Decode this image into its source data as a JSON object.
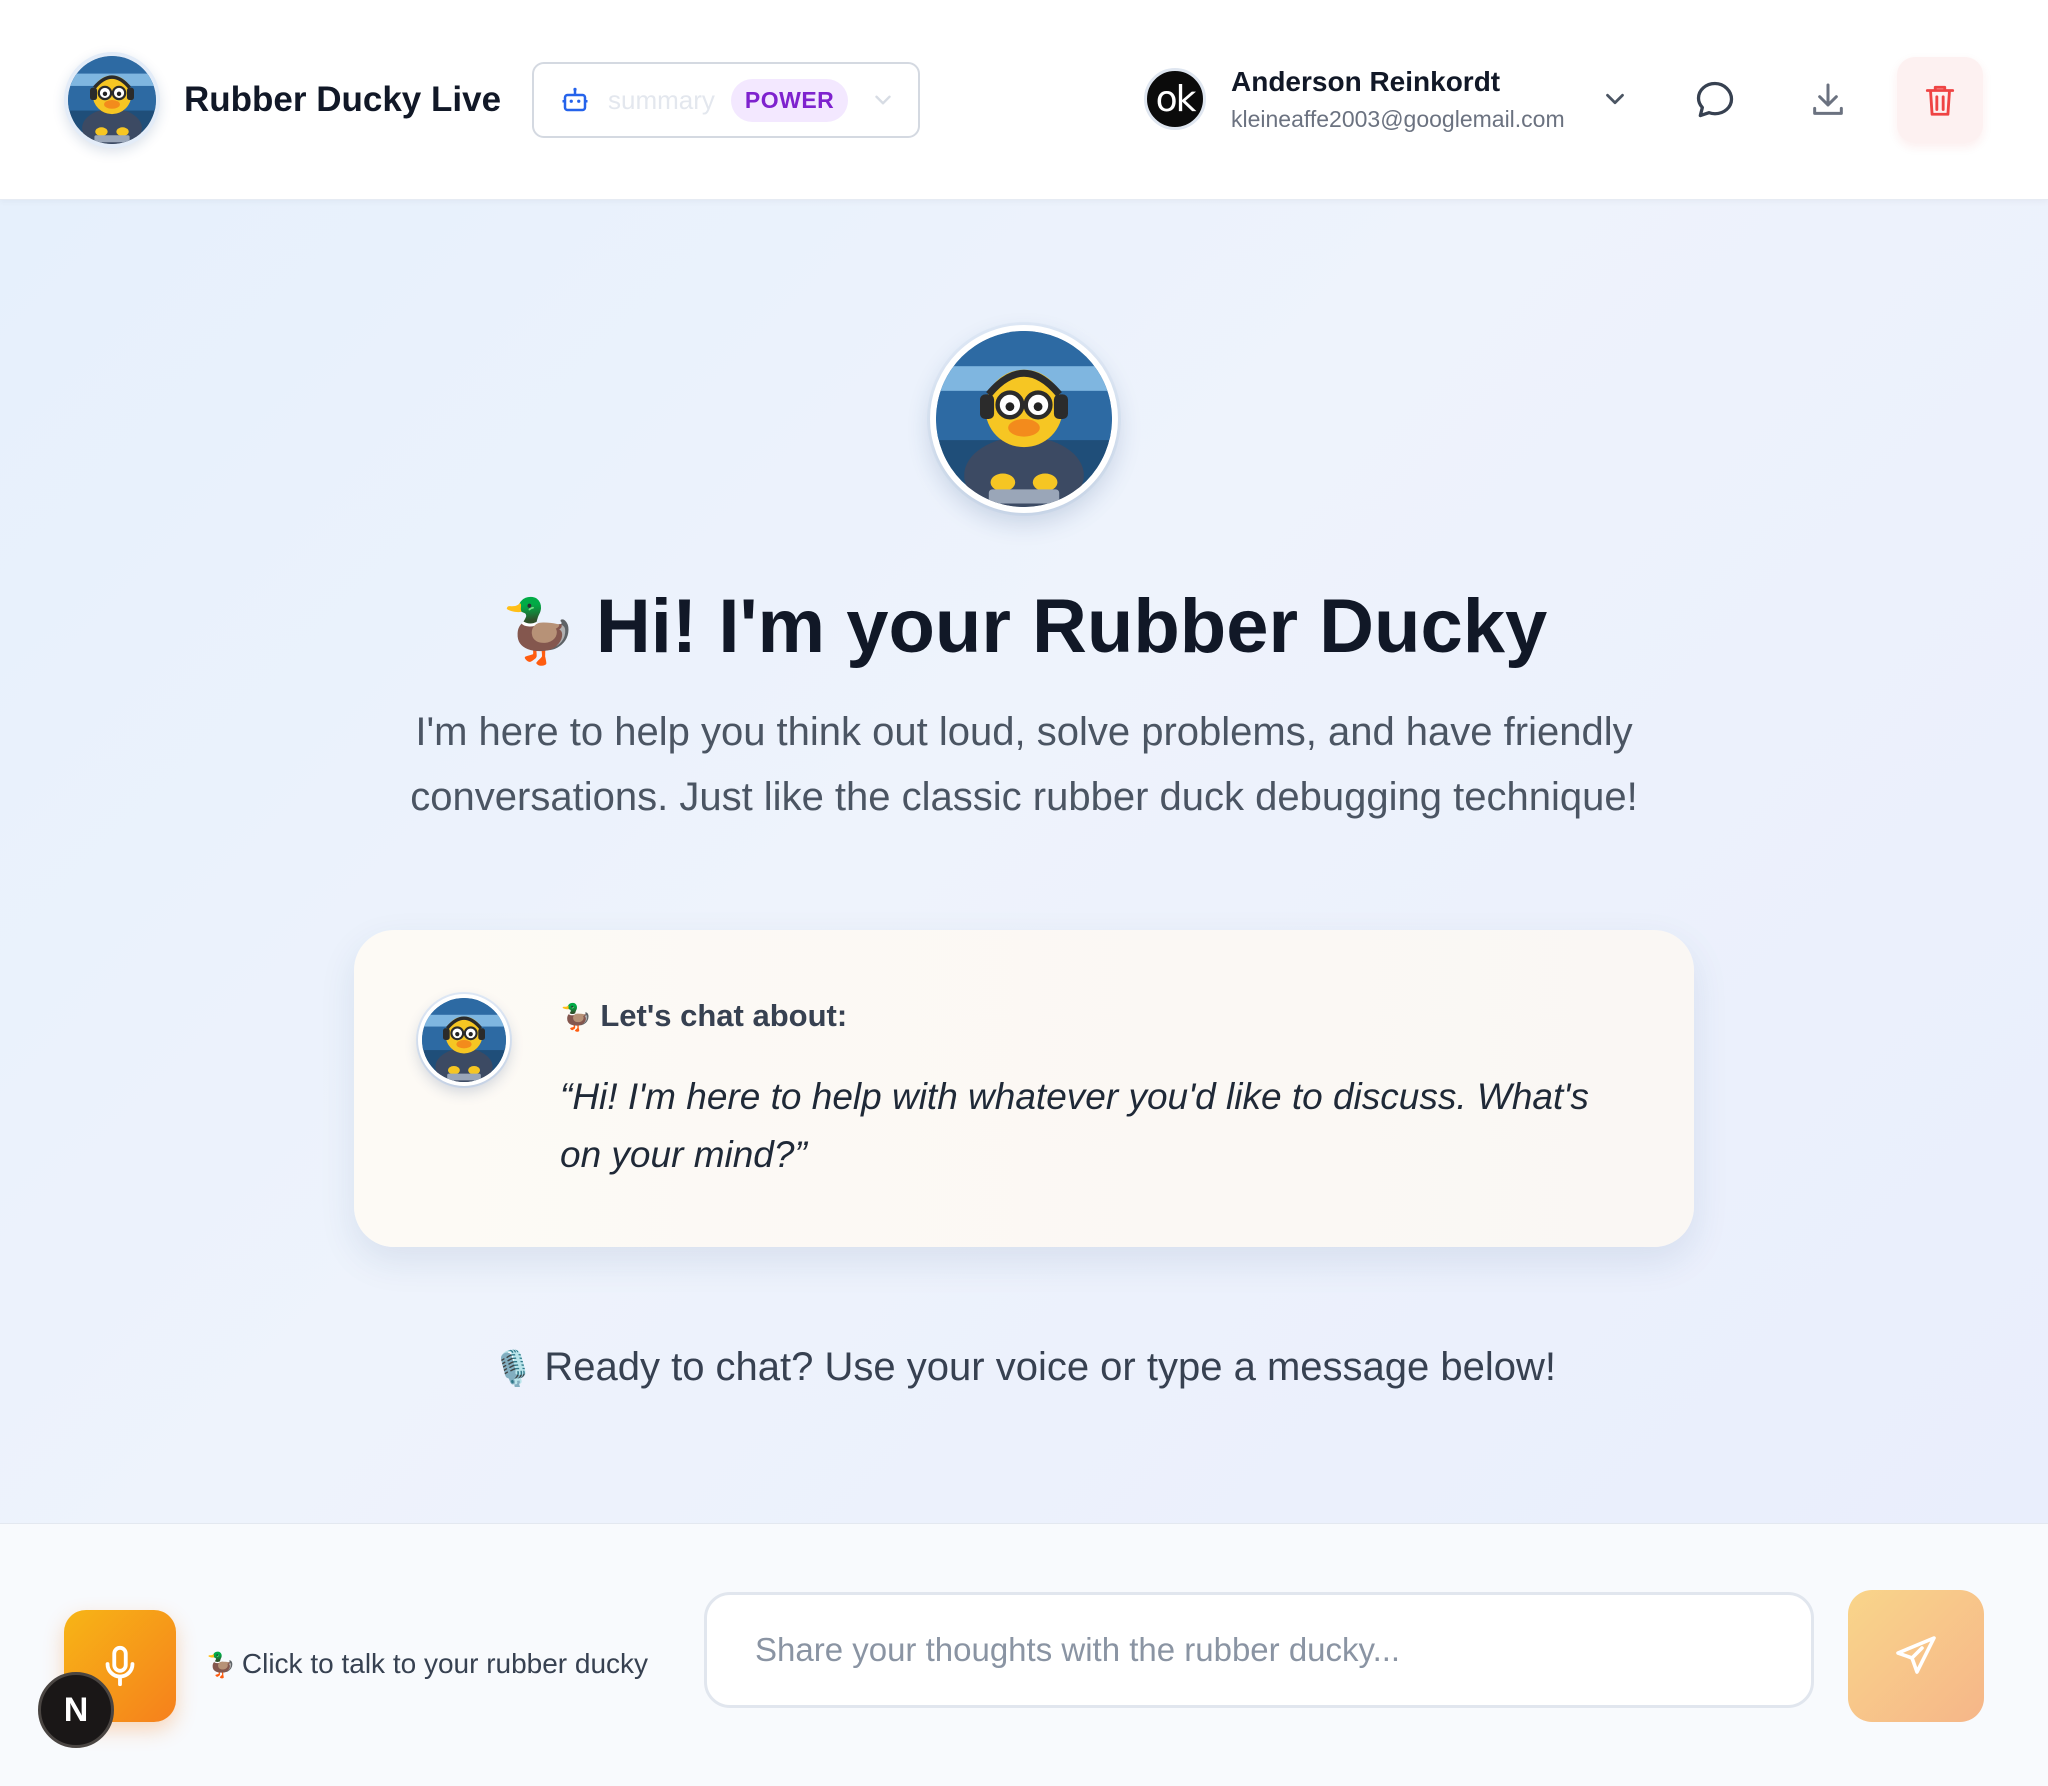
{
  "header": {
    "app_title": "Rubber Ducky Live",
    "model_select": {
      "model_name": "summary",
      "badge": "POWER"
    },
    "user": {
      "avatar_text": "ok",
      "name": "Anderson Reinkordt",
      "email": "kleineaffe2003@googlemail.com"
    }
  },
  "hero": {
    "title_emoji": "🦆",
    "title": "Hi! I'm your Rubber Ducky",
    "subtitle": "I'm here to help you think out loud, solve problems, and have friendly conversations. Just like the classic rubber duck debugging technique!"
  },
  "topic_card": {
    "label_emoji": "🦆",
    "label": "Let's chat about:",
    "quote": "“Hi! I'm here to help with whatever you'd like to discuss. What's on your mind?”"
  },
  "ready": {
    "emoji": "🎙️",
    "text": "Ready to chat? Use your voice or type a message below!"
  },
  "footer": {
    "talk_emoji": "🦆",
    "talk_label": "Click to talk to your rubber ducky",
    "input_placeholder": "Share your thoughts with the rubber ducky...",
    "input_value": ""
  },
  "floating_badge": "N",
  "colors": {
    "accent_orange": "#f6801c",
    "power_badge_bg": "#f3e8ff",
    "power_badge_text": "#7e22ce",
    "trash_red": "#ef4444",
    "heading": "#111827"
  }
}
